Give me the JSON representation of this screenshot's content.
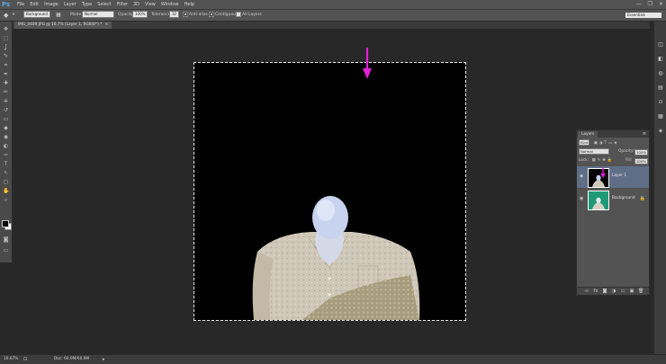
{
  "app": {
    "logo": "Ps"
  },
  "menubar": {
    "items": [
      "File",
      "Edit",
      "Image",
      "Layer",
      "Type",
      "Select",
      "Filter",
      "3D",
      "View",
      "Window",
      "Help"
    ],
    "window_controls": [
      "—",
      "❐",
      "✕"
    ]
  },
  "options": {
    "sample_mode": "Background",
    "mode_label": "Mode:",
    "mode_value": "Normal",
    "opacity_label": "Opacity:",
    "opacity_value": "100%",
    "tolerance_label": "Tolerance:",
    "tolerance_value": "32",
    "antialias_label": "Anti-alias",
    "antialias_checked": true,
    "contiguous_label": "Contiguous",
    "contiguous_checked": true,
    "all_layers_label": "All Layers",
    "all_layers_checked": false,
    "workspace": "Essentials"
  },
  "document": {
    "tab_title": "IMG_0409.JPG @ 16.7% (Layer 1, RGB/8*) *",
    "tab_close": "×"
  },
  "toolbox": {
    "tools": [
      "move-icon",
      "marquee-icon",
      "lasso-icon",
      "quick-select-icon",
      "crop-icon",
      "eyedropper-icon",
      "healing-brush-icon",
      "brush-icon",
      "clone-stamp-icon",
      "history-brush-icon",
      "eraser-icon",
      "paint-bucket-icon",
      "blur-icon",
      "dodge-icon",
      "pen-icon",
      "type-icon",
      "path-select-icon",
      "rectangle-icon",
      "hand-icon",
      "zoom-icon"
    ],
    "glyphs": [
      "✥",
      "⬚",
      "ʆ",
      "✎",
      "⌗",
      "✒",
      "✚",
      "✏",
      "⎈",
      "↺",
      "▭",
      "◆",
      "◉",
      "◐",
      "✑",
      "T",
      "↖",
      "▢",
      "✋",
      "⌕"
    ]
  },
  "dock": {
    "icons": [
      "history-icon",
      "properties-icon",
      "adjustments-icon",
      "styles-icon",
      "brush-panel-icon",
      "swatches-icon",
      "layers-panel-icon"
    ],
    "glyphs": [
      "◫",
      "◧",
      "◍",
      "▤",
      "⊙",
      "▦",
      "◈"
    ]
  },
  "layers_panel": {
    "tab": "Layers",
    "filter_kind": "Kind",
    "blend_mode": "Normal",
    "opacity_label": "Opacity:",
    "opacity_value": "100%",
    "lock_label": "Lock:",
    "fill_label": "Fill:",
    "fill_value": "100%",
    "layers": [
      {
        "name": "Layer 1",
        "selected": true,
        "visible": true
      },
      {
        "name": "Background",
        "selected": false,
        "visible": true
      }
    ],
    "footer_icons": [
      "link-layers-icon",
      "fx-icon",
      "add-mask-icon",
      "adjustment-layer-icon",
      "new-group-icon",
      "new-layer-icon",
      "delete-layer-icon"
    ],
    "footer_glyphs": [
      "∞",
      "fx",
      "◙",
      "◑",
      "▭",
      "▣",
      "🗑"
    ]
  },
  "status": {
    "zoom": "16.67%",
    "doc_size": "Doc: 60.9M/60.9M"
  },
  "colors": {
    "accent_arrow": "#e020d8",
    "foreground": "#000000",
    "background": "#ffffff"
  }
}
